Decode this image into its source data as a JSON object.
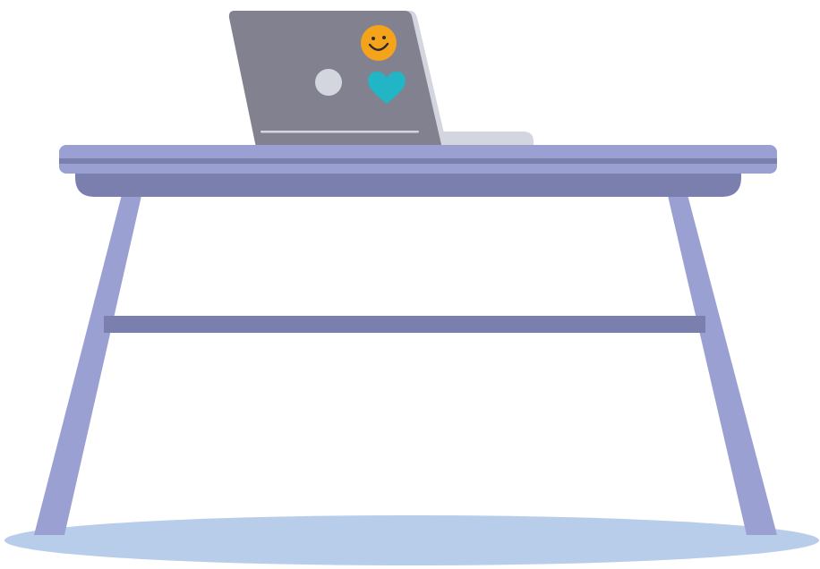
{
  "scene": {
    "subject": "",
    "colors": {
      "background": "#ffffff",
      "floor_shadow": "#b8cdea",
      "table_top_light": "#9aa0d2",
      "table_top_band": "#7a7fae",
      "table_apron": "#7a7fae",
      "table_legs": "#9aa0d2",
      "table_crossbar": "#7a7fae",
      "laptop_lid": "#82818f",
      "laptop_base": "#d3d6de",
      "laptop_hinge_line": "#d3d6de",
      "sticker_circle": "#d3d6de",
      "sticker_smiley": "#f5a31a",
      "sticker_smiley_face": "#2c2a33",
      "sticker_heart": "#22b5c5"
    },
    "icons": {
      "laptop": "laptop-icon",
      "smiley": "smiley-sticker-icon",
      "heart": "heart-sticker-icon",
      "circle": "circle-sticker-icon"
    }
  }
}
